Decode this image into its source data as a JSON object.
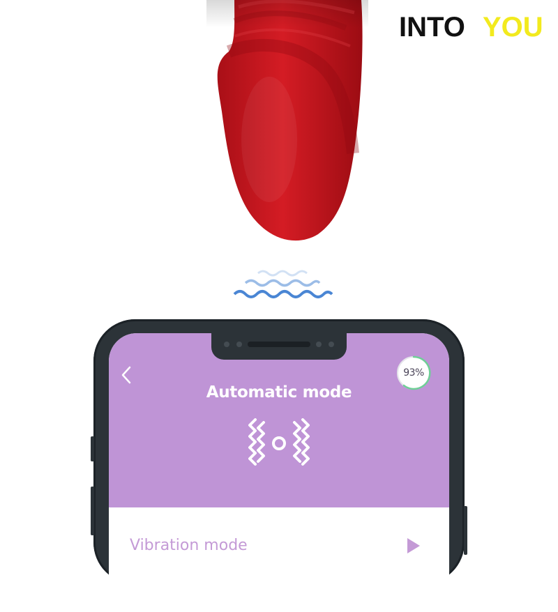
{
  "brand": {
    "logo_text_dark": "INTO",
    "logo_text_accent": "YOU",
    "dark_color": "#111111",
    "accent_color": "#f2ea1e"
  },
  "colors": {
    "product": "#c0141c",
    "waves": "#4a86d4",
    "app_header": "#bf94d6",
    "phone_frame": "#2c3338",
    "battery_ring": "#6fcf97"
  },
  "app": {
    "back_icon": "chevron-left-icon",
    "battery_level": "93%",
    "title": "Automatic mode",
    "mode_icon": "vibration-waves-icon",
    "list_items": [
      {
        "label": "Vibration mode",
        "icon": "play-icon"
      }
    ]
  }
}
